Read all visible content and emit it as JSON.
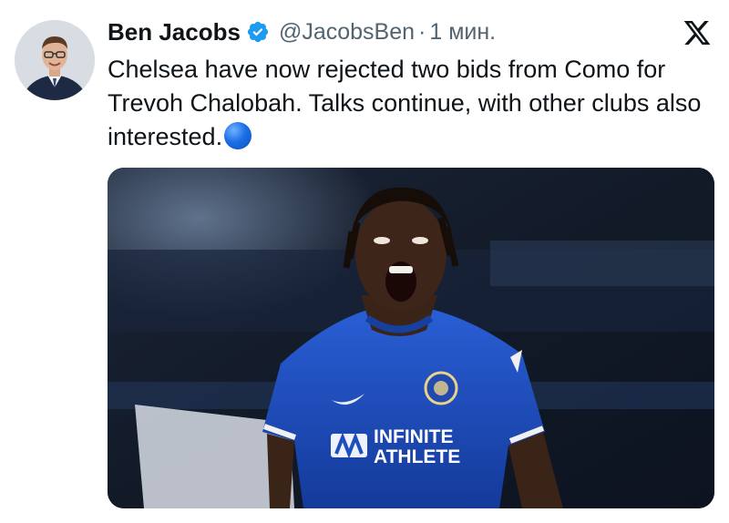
{
  "tweet": {
    "author_name": "Ben Jacobs",
    "handle": "@JacobsBen",
    "separator": "·",
    "time": "1 мин.",
    "text": "Chelsea have now rejected two bids from Como for Trevoh Chalobah. Talks continue, with other clubs also interested.",
    "emoji": "blue-circle",
    "verified_icon": "verified-badge-icon",
    "platform_icon": "x-logo-icon"
  },
  "media": {
    "jersey_sponsor_line1": "INFINITE",
    "jersey_sponsor_line2": "ATHLETE"
  },
  "colors": {
    "text_primary": "#0f1419",
    "text_secondary": "#536471",
    "verified_blue": "#1d9bf0",
    "jersey_blue": "#1f4fbf"
  }
}
